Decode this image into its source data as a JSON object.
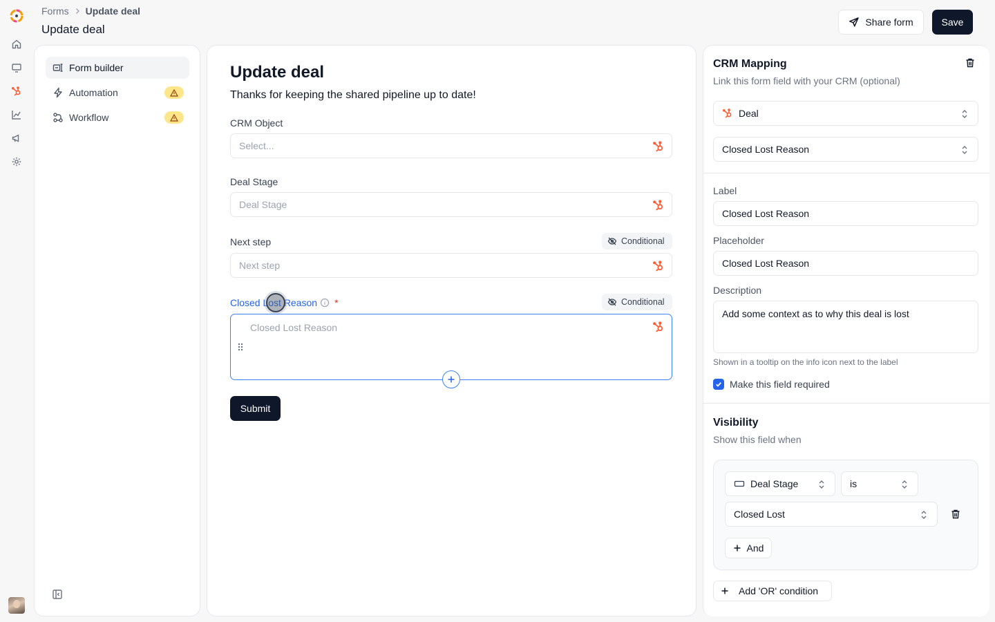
{
  "breadcrumb": {
    "root": "Forms",
    "current": "Update deal"
  },
  "header": {
    "title": "Update deal",
    "share_label": "Share form",
    "save_label": "Save"
  },
  "nav": {
    "items": [
      {
        "label": "Form builder",
        "icon": "form-builder-icon",
        "active": true
      },
      {
        "label": "Automation",
        "icon": "lightning-icon",
        "warning": true
      },
      {
        "label": "Workflow",
        "icon": "workflow-icon",
        "warning": true
      }
    ]
  },
  "form": {
    "title": "Update deal",
    "subtitle": "Thanks for keeping the shared pipeline up to date!",
    "fields": [
      {
        "label": "CRM Object",
        "placeholder": "Select..."
      },
      {
        "label": "Deal Stage",
        "placeholder": "Deal Stage"
      },
      {
        "label": "Next step",
        "placeholder": "Next step",
        "badge": "Conditional"
      }
    ],
    "selected_field": {
      "label": "Closed Lost Reason",
      "required_mark": "*",
      "badge": "Conditional",
      "placeholder": "Closed Lost Reason"
    },
    "submit_label": "Submit"
  },
  "crm_mapping": {
    "title": "CRM Mapping",
    "subtitle": "Link this form field with your CRM (optional)",
    "object": "Deal",
    "property": "Closed Lost Reason"
  },
  "field_settings": {
    "label_title": "Label",
    "label_value": "Closed Lost Reason",
    "placeholder_title": "Placeholder",
    "placeholder_value": "Closed Lost Reason",
    "description_title": "Description",
    "description_value": "Add some context as to why this deal is lost",
    "description_hint": "Shown in a tooltip on the info icon next to the label",
    "required_label": "Make this field required",
    "required": true
  },
  "visibility": {
    "title": "Visibility",
    "subtitle": "Show this field when",
    "condition": {
      "field": "Deal Stage",
      "operator": "is",
      "value": "Closed Lost"
    },
    "and_label": "And",
    "or_label": "Add 'OR' condition"
  },
  "colors": {
    "accent": "#2563eb",
    "primary": "#0f172a",
    "hubspot": "#ff5c35",
    "warning": "#fde68a"
  }
}
